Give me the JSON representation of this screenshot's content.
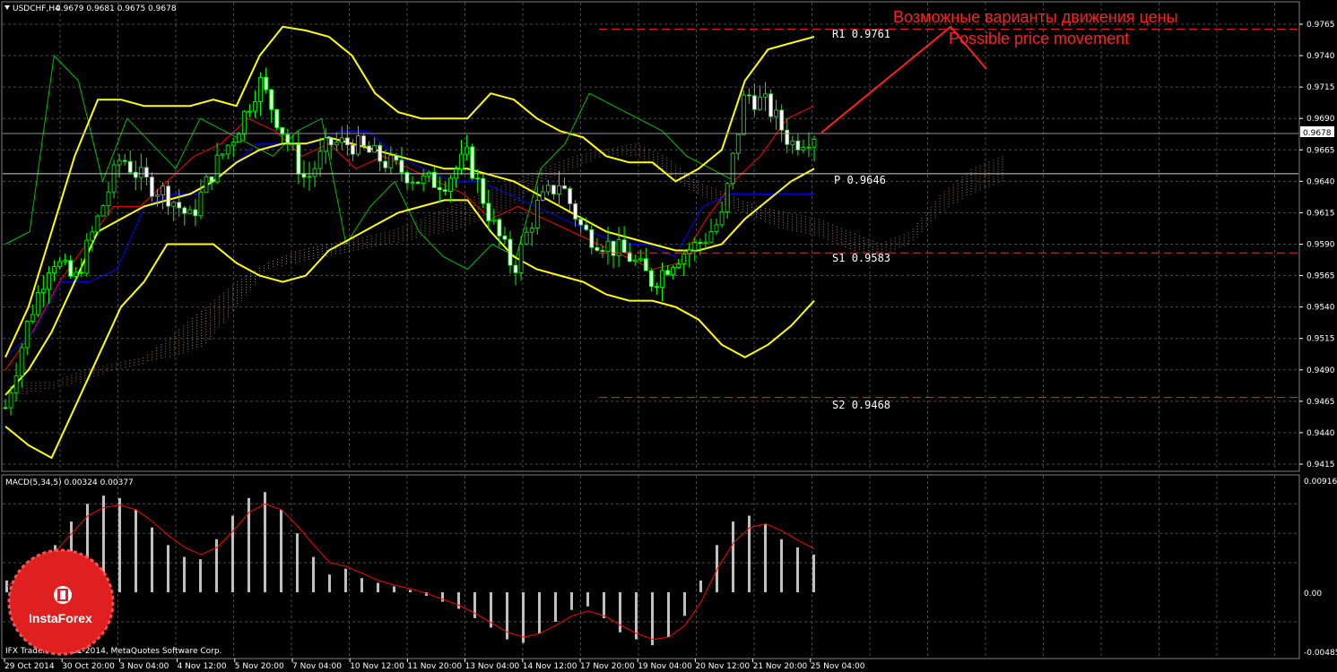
{
  "header": {
    "symbol": "USDCHF,H4",
    "ohlc": "0.9679 0.9681 0.9675 0.9678"
  },
  "annotation": {
    "ru": "Возможные варианты движения цены",
    "en": "Possible price movement"
  },
  "levels": [
    {
      "label": "R1",
      "value": "0.9761"
    },
    {
      "label": "P",
      "value": "0.9646"
    },
    {
      "label": "S1",
      "value": "0.9583"
    },
    {
      "label": "S2",
      "value": "0.9468"
    }
  ],
  "current_price": "0.9678",
  "price_axis": [
    "0.9765",
    "0.9740",
    "0.9715",
    "0.9690",
    "0.9665",
    "0.9640",
    "0.9615",
    "0.9590",
    "0.9565",
    "0.9540",
    "0.9515",
    "0.9490",
    "0.9465",
    "0.9440",
    "0.9415"
  ],
  "macd": {
    "label": "MACD(5,34,5) 0.00324 0.00377",
    "axis": [
      "0.00916",
      "0.00",
      "-0.00485"
    ]
  },
  "time_axis": [
    "29 Oct 2014",
    "30 Oct 20:00",
    "3 Nov 04:00",
    "4 Nov 12:00",
    "5 Nov 20:00",
    "7 Nov 04:00",
    "10 Nov 12:00",
    "11 Nov 20:00",
    "13 Nov 04:00",
    "14 Nov 12:00",
    "17 Nov 20:00",
    "19 Nov 04:00",
    "20 Nov 12:00",
    "21 Nov 20:00",
    "25 Nov 04:00"
  ],
  "copyright": "IFX Trader, © 2001-2014, MetaQuotes Software Corp.",
  "logo": {
    "text": "InstaForex"
  },
  "colors": {
    "background": "#000000",
    "grid": "#4a4a4a",
    "bull": "#000000",
    "bear": "#ffffff",
    "candle_outline": "#00ff00",
    "bollinger": "#ffff00",
    "tenkan": "#ff0000",
    "kijun": "#0000ff",
    "chikou": "#00c000",
    "cloud_up": "#c8a070",
    "cloud_down": "#ffffff",
    "macd_hist": "#c0c0c0",
    "macd_signal": "#ff0000",
    "annotation": "#ff2020",
    "level_line": "#c04040",
    "logo": "#e02020"
  },
  "chart_data": {
    "type": "candlestick",
    "title": "USDCHF,H4",
    "ylim": [
      0.9405,
      0.9785
    ],
    "x": [
      "29 Oct 2014",
      "30 Oct 20:00",
      "3 Nov 04:00",
      "4 Nov 12:00",
      "5 Nov 20:00",
      "7 Nov 04:00",
      "10 Nov 12:00",
      "11 Nov 20:00",
      "13 Nov 04:00",
      "14 Nov 12:00",
      "17 Nov 20:00",
      "19 Nov 04:00",
      "20 Nov 12:00",
      "21 Nov 20:00",
      "25 Nov 04:00"
    ],
    "close_path": [
      0.946,
      0.953,
      0.958,
      0.956,
      0.961,
      0.966,
      0.964,
      0.963,
      0.961,
      0.965,
      0.968,
      0.972,
      0.968,
      0.964,
      0.967,
      0.967,
      0.966,
      0.965,
      0.964,
      0.964,
      0.966,
      0.961,
      0.957,
      0.962,
      0.964,
      0.96,
      0.959,
      0.958,
      0.956,
      0.958,
      0.959,
      0.961,
      0.971,
      0.97,
      0.967,
      0.9678
    ],
    "bollinger_upper": [
      0.95,
      0.954,
      0.96,
      0.966,
      0.9705,
      0.9705,
      0.97,
      0.97,
      0.97,
      0.9705,
      0.97,
      0.974,
      0.9763,
      0.976,
      0.9755,
      0.974,
      0.971,
      0.9695,
      0.969,
      0.969,
      0.969,
      0.971,
      0.9705,
      0.969,
      0.968,
      0.9675,
      0.966,
      0.9655,
      0.9655,
      0.964,
      0.965,
      0.9665,
      0.972,
      0.9745,
      0.975,
      0.9755
    ],
    "bollinger_middle": [
      0.947,
      0.949,
      0.952,
      0.956,
      0.96,
      0.961,
      0.962,
      0.9625,
      0.963,
      0.964,
      0.9655,
      0.9665,
      0.967,
      0.967,
      0.9675,
      0.967,
      0.9665,
      0.966,
      0.9655,
      0.965,
      0.965,
      0.9645,
      0.964,
      0.963,
      0.962,
      0.961,
      0.96,
      0.9595,
      0.959,
      0.9585,
      0.9585,
      0.959,
      0.961,
      0.9625,
      0.964,
      0.965
    ],
    "bollinger_lower": [
      0.9445,
      0.943,
      0.942,
      0.946,
      0.95,
      0.954,
      0.956,
      0.959,
      0.959,
      0.959,
      0.9575,
      0.9565,
      0.956,
      0.9565,
      0.9585,
      0.9595,
      0.9605,
      0.9615,
      0.962,
      0.9625,
      0.9625,
      0.96,
      0.958,
      0.957,
      0.9565,
      0.956,
      0.955,
      0.9545,
      0.9545,
      0.954,
      0.953,
      0.951,
      0.95,
      0.951,
      0.9525,
      0.9545
    ],
    "levels": {
      "R1": 0.9761,
      "P": 0.9646,
      "S1": 0.9583,
      "S2": 0.9468
    },
    "macd": {
      "ylim": [
        -0.00485,
        0.00916
      ],
      "histogram": [
        0.001,
        0.002,
        0.003,
        0.004,
        0.006,
        0.0075,
        0.0082,
        0.008,
        0.007,
        0.0055,
        0.004,
        0.003,
        0.0028,
        0.0045,
        0.0065,
        0.008,
        0.0085,
        0.007,
        0.005,
        0.003,
        0.0015,
        0.002,
        0.0012,
        0.0008,
        0.0005,
        0.0002,
        -0.0003,
        -0.0008,
        -0.0014,
        -0.0022,
        -0.003,
        -0.004,
        -0.0043,
        -0.0035,
        -0.0025,
        -0.0015,
        -0.0012,
        -0.0022,
        -0.0034,
        -0.004,
        -0.0045,
        -0.0038,
        -0.002,
        0.001,
        0.004,
        0.006,
        0.0065,
        0.0058,
        0.0045,
        0.0038,
        0.0032
      ],
      "signal": [
        0.0005,
        0.0015,
        0.0025,
        0.0035,
        0.005,
        0.0065,
        0.0072,
        0.0074,
        0.007,
        0.006,
        0.0048,
        0.0038,
        0.0032,
        0.0038,
        0.0052,
        0.0068,
        0.0075,
        0.007,
        0.0056,
        0.004,
        0.0025,
        0.0022,
        0.0016,
        0.001,
        0.0006,
        0.0003,
        -0.0001,
        -0.0006,
        -0.0011,
        -0.0018,
        -0.0026,
        -0.0034,
        -0.0038,
        -0.0035,
        -0.0028,
        -0.002,
        -0.0016,
        -0.002,
        -0.0028,
        -0.0035,
        -0.004,
        -0.0038,
        -0.0028,
        -0.0008,
        0.002,
        0.0042,
        0.0055,
        0.0058,
        0.0052,
        0.0044,
        0.0037
      ]
    }
  }
}
